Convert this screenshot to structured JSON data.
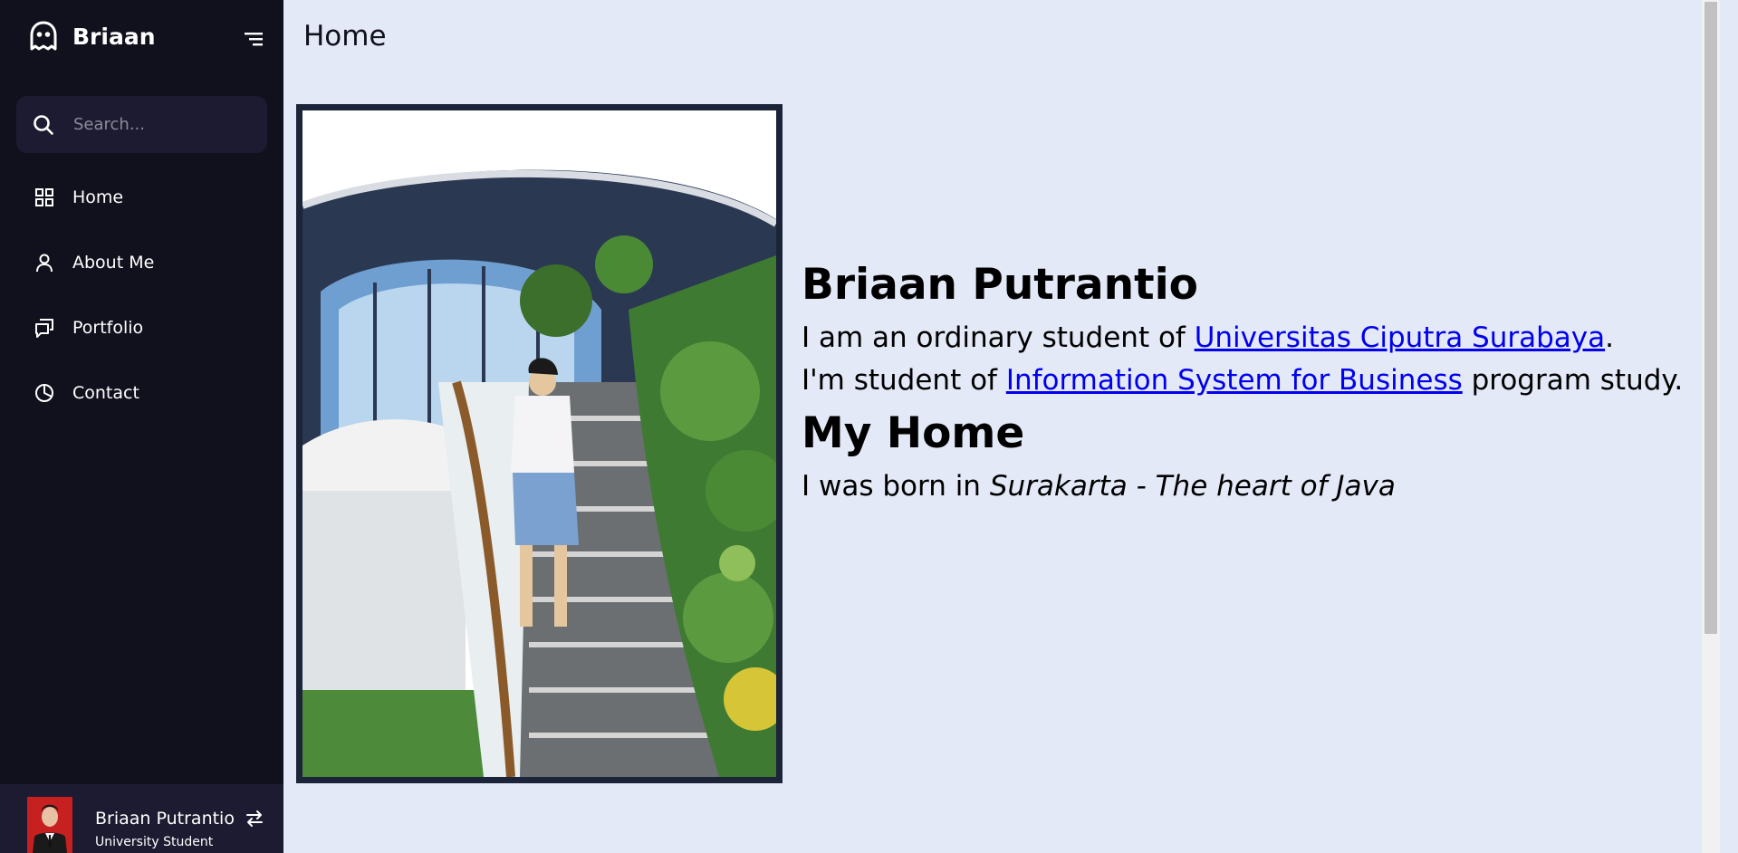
{
  "sidebar": {
    "logo_name": "Briaan",
    "search_placeholder": "Search...",
    "items": [
      {
        "label": "Home",
        "icon": "grid-icon"
      },
      {
        "label": "About Me",
        "icon": "user-icon"
      },
      {
        "label": "Portfolio",
        "icon": "chat-icon"
      },
      {
        "label": "Contact",
        "icon": "pie-chart-icon"
      }
    ],
    "profile": {
      "name": "Briaan Putrantio",
      "job": "University Student"
    }
  },
  "main": {
    "page_title": "Home",
    "heading": "Briaan Putrantio",
    "line1_prefix": "I am an ordinary student of ",
    "line1_link": "Universitas Ciputra Surabaya",
    "line1_suffix": ".",
    "line2_prefix": "I'm student of ",
    "line2_link": "Information System for Business",
    "line2_suffix": " program study.",
    "subheading": "My Home",
    "line3_prefix": "I was born in ",
    "line3_emphasis": "Surakarta - The heart of Java"
  },
  "colors": {
    "sidebar_bg": "#11101d",
    "sidebar_accent": "#1d1b31",
    "page_bg": "#e4e9f7",
    "link": "#0000ee"
  }
}
